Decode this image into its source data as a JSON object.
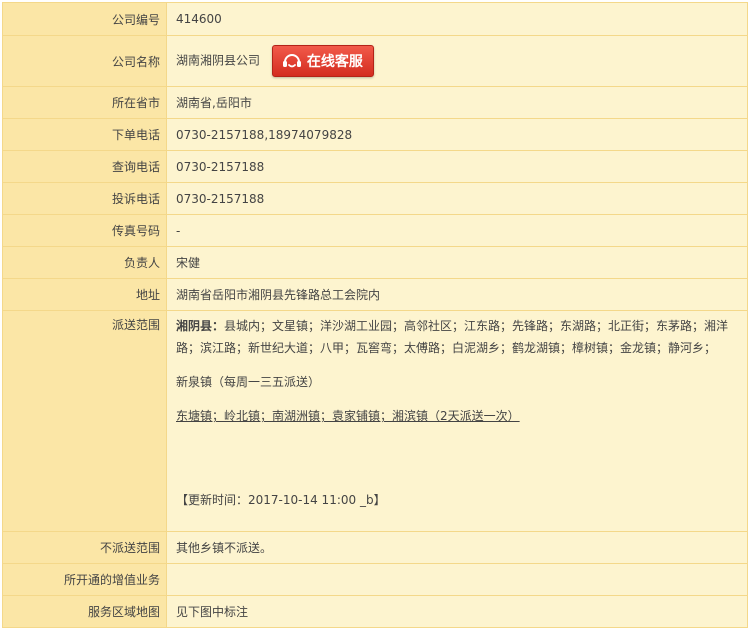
{
  "rows": {
    "company_code": {
      "label": "公司编号",
      "value": "414600"
    },
    "company_name": {
      "label": "公司名称",
      "value": "湖南湘阴县公司",
      "service_button": "在线客服"
    },
    "province_city": {
      "label": "所在省市",
      "value": "湖南省,岳阳市"
    },
    "order_phone": {
      "label": "下单电话",
      "value": "0730-2157188,18974079828"
    },
    "query_phone": {
      "label": "查询电话",
      "value": "0730-2157188"
    },
    "complaint_phone": {
      "label": "投诉电话",
      "value": "0730-2157188"
    },
    "fax": {
      "label": "传真号码",
      "value": "-"
    },
    "manager": {
      "label": "负责人",
      "value": "宋健"
    },
    "address": {
      "label": "地址",
      "value": "湖南省岳阳市湘阴县先锋路总工会院内"
    },
    "delivery_scope": {
      "label": "派送范围",
      "region_title": "湘阴县：",
      "region_text": "县城内；文星镇；洋沙湖工业园；高邻社区；江东路；先锋路；东湖路；北正街；东茅路；湘洋路；滨江路；新世纪大道；八甲；瓦窖弯；太傅路；白泥湖乡；鹤龙湖镇；樟树镇；金龙镇；静河乡；",
      "line2": "新泉镇（每周一三五派送）",
      "line3": "东塘镇；岭北镇；南湖洲镇；袁家铺镇；湘滨镇（2天派送一次）",
      "update_time": "【更新时间：2017-10-14 11:00 _b】"
    },
    "non_delivery": {
      "label": "不派送范围",
      "value": "其他乡镇不派送。"
    },
    "value_added": {
      "label": "所开通的增值业务",
      "value": ""
    },
    "service_map": {
      "label": "服务区域地图",
      "value": "见下图中标注"
    }
  },
  "colors": {
    "label_bg": "#fbe6a6",
    "value_bg": "#fdf4cf",
    "border": "#f4d88a",
    "button_red": "#d42c20"
  },
  "icons": {
    "service_button_icon": "headset-smile-icon"
  }
}
